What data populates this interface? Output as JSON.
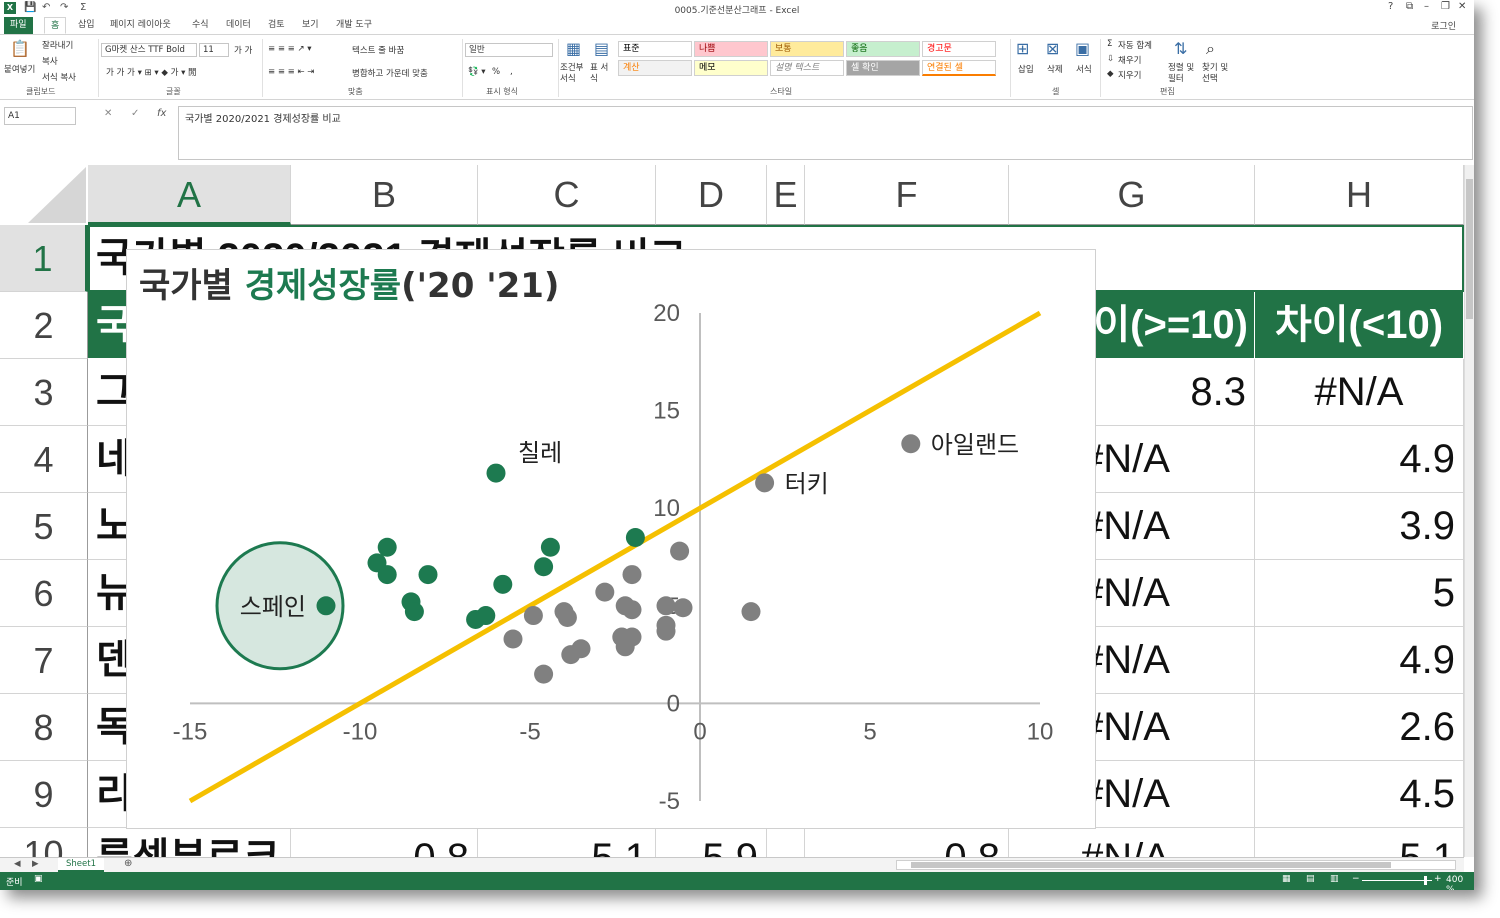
{
  "window": {
    "title": "0005.기준선분산그래프 - Excel",
    "login": "로그인",
    "controls": [
      "?",
      "⧉",
      "–",
      "❐",
      "✕"
    ]
  },
  "ribbon_tabs": [
    "파일",
    "홈",
    "삽입",
    "페이지 레이아웃",
    "수식",
    "데이터",
    "검토",
    "보기",
    "개발 도구"
  ],
  "ribbon": {
    "clipboard": {
      "paste": "붙여넣기",
      "cut": "잘라내기",
      "copy": "복사",
      "format_painter": "서식 복사",
      "group": "클립보드"
    },
    "font": {
      "name": "G마켓 산스 TTF Bold",
      "size": "11",
      "group": "글꼴"
    },
    "alignment": {
      "wrap": "텍스트 줄 바꿈",
      "merge": "병합하고 가운데 맞춤",
      "group": "맞춤"
    },
    "number": {
      "format": "일반",
      "percent": "%",
      "comma": ",",
      "group": "표시 형식"
    },
    "conditional": "조건부 서식",
    "table": "표 서식",
    "styles": {
      "group": "스타일",
      "cells": [
        {
          "label": "표준",
          "bg": "#ffffff",
          "fg": "#000000"
        },
        {
          "label": "나쁨",
          "bg": "#ffc7ce",
          "fg": "#9c0006"
        },
        {
          "label": "보통",
          "bg": "#ffeb9c",
          "fg": "#9c5700"
        },
        {
          "label": "좋음",
          "bg": "#c6efce",
          "fg": "#006100"
        },
        {
          "label": "경고문",
          "bg": "#ffffff",
          "fg": "#ff0000"
        },
        {
          "label": "계산",
          "bg": "#f2f2f2",
          "fg": "#fa7d00"
        },
        {
          "label": "메모",
          "bg": "#ffffcc",
          "fg": "#000000"
        },
        {
          "label": "설명 텍스트",
          "bg": "#ffffff",
          "fg": "#7f7f7f"
        },
        {
          "label": "셀 확인",
          "bg": "#a5a5a5",
          "fg": "#ffffff"
        },
        {
          "label": "연결된 셀",
          "bg": "#ffffff",
          "fg": "#fa7d00"
        }
      ]
    },
    "cells_group": {
      "insert": "삽입",
      "delete": "삭제",
      "format": "서식",
      "group": "셀"
    },
    "editing": {
      "autosum": "자동 합계",
      "fill": "채우기",
      "clear": "지우기",
      "sort": "정렬 및 필터",
      "find": "찾기 및 선택",
      "group": "편집"
    }
  },
  "formula_bar": {
    "name_box": "A1",
    "fx": "fx",
    "content": "국가별 2020/2021 경제성장률 비교"
  },
  "columns": [
    "A",
    "B",
    "C",
    "D",
    "E",
    "F",
    "G",
    "H"
  ],
  "rows": [
    "1",
    "2",
    "3",
    "4",
    "5",
    "6",
    "7",
    "8",
    "9",
    "10"
  ],
  "sheet": {
    "title_cell": "국가별 2020/2021 경제성장률 비교",
    "header_row": {
      "a": "국",
      "g": "차이(>=10)",
      "h": "차이(<10)"
    },
    "data_rows": [
      {
        "a": "그",
        "g": "8.3",
        "h": "#N/A"
      },
      {
        "a": "네",
        "g": "#N/A",
        "h": "4.9"
      },
      {
        "a": "노",
        "g": "#N/A",
        "h": "3.9"
      },
      {
        "a": "뉴",
        "g": "#N/A",
        "h": "5"
      },
      {
        "a": "덴",
        "g": "#N/A",
        "h": "4.9"
      },
      {
        "a": "독",
        "g": "#N/A",
        "h": "2.6"
      },
      {
        "a": "리",
        "g": "#N/A",
        "h": "4.5"
      },
      {
        "a": "룩셈부르크",
        "b": "-0.8",
        "c": "5.1",
        "d": "5.9",
        "f": "-0.8",
        "g": "#N/A",
        "h": "5.1"
      }
    ]
  },
  "chart_data": {
    "type": "scatter",
    "title": "국가별 경제성장률('20 '21)",
    "title_plain": "국가별 ",
    "title_accent": "경제성장률",
    "title_tail": "('20 '21)",
    "xlim": [
      -15,
      10
    ],
    "ylim": [
      -5,
      20
    ],
    "x_ticks": [
      -15,
      -10,
      -5,
      0,
      5,
      10
    ],
    "y_ticks": [
      -5,
      0,
      5,
      10,
      15,
      20
    ],
    "colors": {
      "green": "#1d7a50",
      "gray": "#808080",
      "line": "#f5c000",
      "highlight_fill": "#d6e7df"
    },
    "baseline": {
      "x1": -15,
      "y1": -5,
      "x2": 10,
      "y2": 20
    },
    "series": [
      {
        "name": "차이(>=10)",
        "color": "green",
        "points": [
          [
            -6,
            11.8
          ],
          [
            -9.2,
            8
          ],
          [
            -9.5,
            7.2
          ],
          [
            -9.2,
            6.6
          ],
          [
            -8,
            6.6
          ],
          [
            -8.5,
            5.2
          ],
          [
            -8.4,
            4.7
          ],
          [
            -6.6,
            4.3
          ],
          [
            -6.3,
            4.5
          ],
          [
            -5.8,
            6.1
          ],
          [
            -4.6,
            7
          ],
          [
            -4.4,
            8
          ],
          [
            -1.9,
            8.5
          ],
          [
            -11,
            5
          ]
        ]
      },
      {
        "name": "차이(<10)",
        "color": "gray",
        "points": [
          [
            1.9,
            11.3
          ],
          [
            6.2,
            13.3
          ],
          [
            -0.6,
            7.8
          ],
          [
            -2,
            6.6
          ],
          [
            -2.8,
            5.7
          ],
          [
            -2.2,
            5
          ],
          [
            -2,
            4.8
          ],
          [
            -1,
            5
          ],
          [
            -0.5,
            4.9
          ],
          [
            -1,
            4
          ],
          [
            -1,
            3.7
          ],
          [
            1.5,
            4.7
          ],
          [
            -2.3,
            3.4
          ],
          [
            -2,
            3.4
          ],
          [
            -2.2,
            2.9
          ],
          [
            -3.5,
            2.8
          ],
          [
            -3.8,
            2.5
          ],
          [
            -4.9,
            4.5
          ],
          [
            -4,
            4.7
          ],
          [
            -3.9,
            4.4
          ],
          [
            -5.5,
            3.3
          ],
          [
            -4.6,
            1.5
          ]
        ]
      }
    ],
    "labels": [
      {
        "text": "칠레",
        "x": -6,
        "y": 11.8
      },
      {
        "text": "터키",
        "x": 1.9,
        "y": 11.3
      },
      {
        "text": "아일랜드",
        "x": 6.2,
        "y": 13.3
      },
      {
        "text": "스페인",
        "x": -11,
        "y": 5
      }
    ]
  },
  "sheet_tab": "Sheet1",
  "status": {
    "ready": "준비",
    "zoom": "400 %"
  }
}
